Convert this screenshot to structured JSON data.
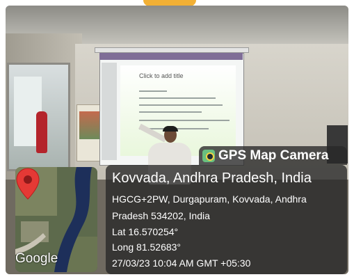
{
  "badge": {
    "app_name": "GPS Map Camera",
    "icon": "camera-location-icon"
  },
  "location": {
    "title": "Kovvada, Andhra Pradesh, India",
    "address_line1": "HGCG+2PW, Durgapuram, Kovvada, Andhra",
    "address_line2": "Pradesh 534202, India",
    "latitude": "Lat 16.570254°",
    "longitude": "Long 81.52683°",
    "datetime": "27/03/23 10:04 AM GMT +05:30"
  },
  "map": {
    "provider": "Google",
    "pin_icon": "location-pin-icon",
    "pin_color": "#e53935"
  },
  "slide": {
    "title": "Click to add title"
  },
  "colors": {
    "overlay": "#282828",
    "badge_icon": "#69c07f",
    "accent_tab": "#f2b035"
  }
}
